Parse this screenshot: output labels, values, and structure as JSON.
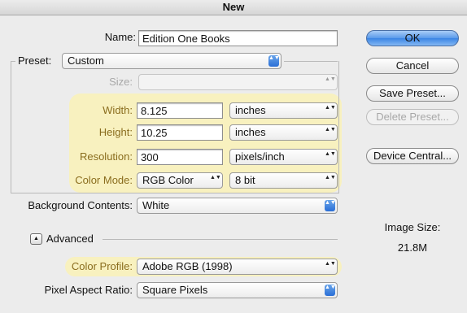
{
  "window": {
    "title": "New"
  },
  "name": {
    "label": "Name:",
    "value": "Edition One Books"
  },
  "preset": {
    "label": "Preset:",
    "value": "Custom"
  },
  "size": {
    "label": "Size:",
    "value": ""
  },
  "width": {
    "label": "Width:",
    "value": "8.125",
    "unit": "inches"
  },
  "height": {
    "label": "Height:",
    "value": "10.25",
    "unit": "inches"
  },
  "resolution": {
    "label": "Resolution:",
    "value": "300",
    "unit": "pixels/inch"
  },
  "color_mode": {
    "label": "Color Mode:",
    "mode": "RGB Color",
    "depth": "8 bit"
  },
  "background": {
    "label": "Background Contents:",
    "value": "White"
  },
  "advanced": {
    "label": "Advanced"
  },
  "color_profile": {
    "label": "Color Profile:",
    "value": "Adobe RGB (1998)"
  },
  "pixel_aspect": {
    "label": "Pixel Aspect Ratio:",
    "value": "Square Pixels"
  },
  "buttons": {
    "ok": "OK",
    "cancel": "Cancel",
    "save_preset": "Save Preset...",
    "delete_preset": "Delete Preset...",
    "device_central": "Device Central..."
  },
  "image_size": {
    "label": "Image Size:",
    "value": "21.8M"
  },
  "icons": {
    "popup_arrows": "▲▼",
    "disclosure": "▲"
  },
  "colors": {
    "highlight": "#f8f1bf",
    "highlight_text": "#8a6d1e",
    "default_button": "#3a84e4"
  }
}
